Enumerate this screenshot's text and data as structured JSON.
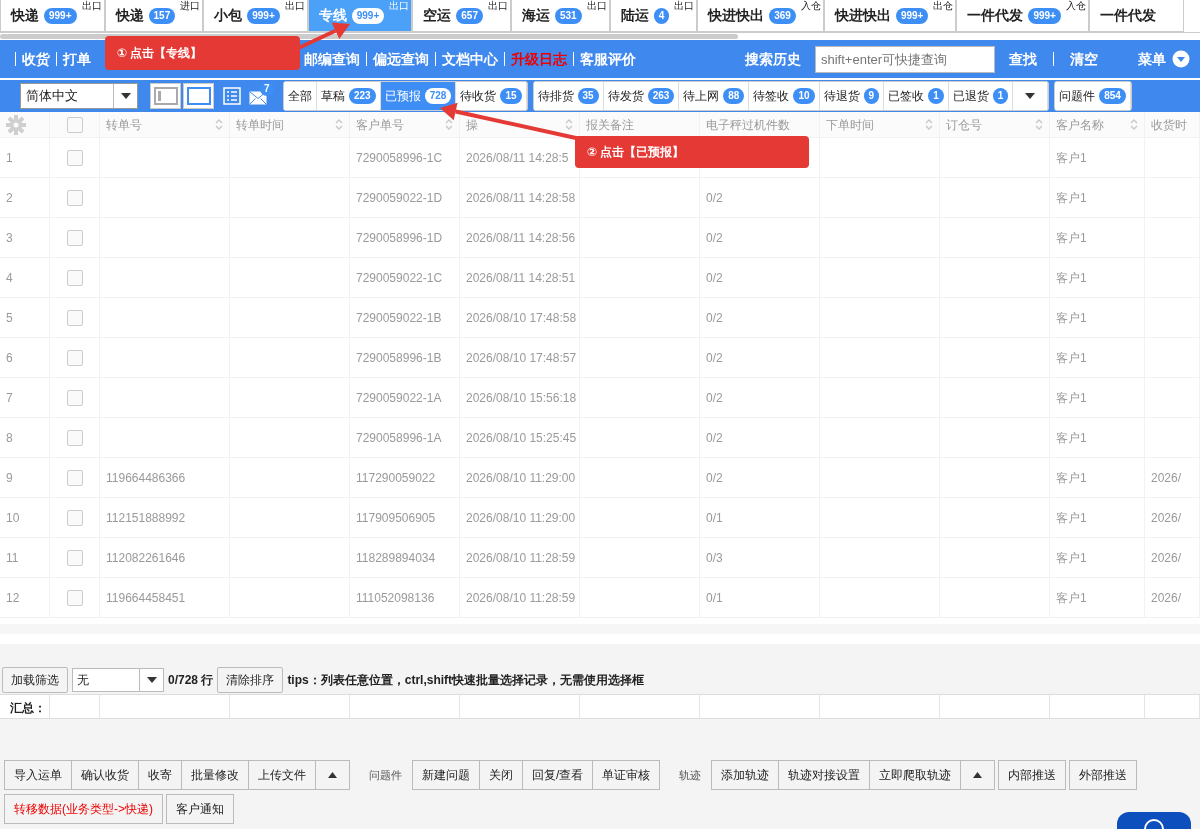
{
  "module_tabs": [
    {
      "label": "快递",
      "count": "999+",
      "tag": "出口",
      "selected": false
    },
    {
      "label": "快递",
      "count": "157",
      "tag": "进口",
      "selected": false
    },
    {
      "label": "小包",
      "count": "999+",
      "tag": "出口",
      "selected": false
    },
    {
      "label": "专线",
      "count": "999+",
      "tag": "出口",
      "selected": true
    },
    {
      "label": "空运",
      "count": "657",
      "tag": "出口",
      "selected": false
    },
    {
      "label": "海运",
      "count": "531",
      "tag": "出口",
      "selected": false
    },
    {
      "label": "陆运",
      "count": "4",
      "tag": "出口",
      "selected": false
    },
    {
      "label": "快进快出",
      "count": "369",
      "tag": "入仓",
      "selected": false
    },
    {
      "label": "快进快出",
      "count": "999+",
      "tag": "出仓",
      "selected": false
    },
    {
      "label": "一件代发",
      "count": "999+",
      "tag": "入仓",
      "selected": false
    },
    {
      "label": "一件代发",
      "selected": false
    }
  ],
  "nav": {
    "links": [
      {
        "label": "收货",
        "highlight": false
      },
      {
        "label": "打单",
        "highlight": false
      },
      {
        "label": "邮编查询",
        "highlight": false
      },
      {
        "label": "偏远查询",
        "highlight": false
      },
      {
        "label": "文档中心",
        "highlight": false
      },
      {
        "label": "升级日志",
        "highlight": true
      },
      {
        "label": "客服评价",
        "highlight": false
      }
    ],
    "search_history": "搜索历史",
    "search": {
      "placeholder": "shift+enter可快捷查询"
    },
    "find": "查找",
    "clear": "清空",
    "menu": "菜单"
  },
  "toolbar": {
    "language": "简体中文",
    "layouts": [
      {
        "selected": false
      },
      {
        "selected": true
      }
    ],
    "mail_count": "7",
    "status_groups": [
      {
        "menu": false,
        "items": [
          {
            "label": "全部",
            "selected": false
          },
          {
            "label": "草稿",
            "count": "223",
            "selected": false
          },
          {
            "label": "已预报",
            "count": "728",
            "selected": true
          },
          {
            "label": "待收货",
            "count": "15",
            "selected": false
          }
        ]
      },
      {
        "menu": true,
        "items": [
          {
            "label": "待排货",
            "count": "35",
            "selected": false
          },
          {
            "label": "待发货",
            "count": "263",
            "selected": false
          },
          {
            "label": "待上网",
            "count": "88",
            "selected": false
          },
          {
            "label": "待签收",
            "count": "10",
            "selected": false
          },
          {
            "label": "待退货",
            "count": "9",
            "selected": false
          },
          {
            "label": "已签收",
            "count": "1",
            "selected": false
          },
          {
            "label": "已退货",
            "count": "1",
            "selected": false
          }
        ]
      },
      {
        "menu": false,
        "items": [
          {
            "label": "问题件",
            "count": "854",
            "selected": false
          }
        ]
      }
    ]
  },
  "table": {
    "select_all": {
      "checked": false
    },
    "columns": [
      {
        "label": "转单号",
        "sortable": true
      },
      {
        "label": "转单时间",
        "sortable": true
      },
      {
        "label": "客户单号",
        "sortable": true
      },
      {
        "label": "操",
        "sortable": true
      },
      {
        "label": "报关备注",
        "sortable": false
      },
      {
        "label": "电子秤过机件数",
        "sortable": false
      },
      {
        "label": "下单时间",
        "sortable": true
      },
      {
        "label": "订仓号",
        "sortable": true
      },
      {
        "label": "客户名称",
        "sortable": true
      },
      {
        "label": "收货时",
        "sortable": false
      }
    ],
    "rows": [
      {
        "no": "1",
        "checked": false,
        "cells": [
          null,
          null,
          "7290058996-1C",
          "2026/08/11 14:28:5",
          null,
          null,
          null,
          null,
          "客户1",
          null
        ]
      },
      {
        "no": "2",
        "checked": false,
        "cells": [
          null,
          null,
          "7290059022-1D",
          "2026/08/11 14:28:58",
          null,
          "0/2",
          null,
          null,
          "客户1",
          null
        ]
      },
      {
        "no": "3",
        "checked": false,
        "cells": [
          null,
          null,
          "7290058996-1D",
          "2026/08/11 14:28:56",
          null,
          "0/2",
          null,
          null,
          "客户1",
          null
        ]
      },
      {
        "no": "4",
        "checked": false,
        "cells": [
          null,
          null,
          "7290059022-1C",
          "2026/08/11 14:28:51",
          null,
          "0/2",
          null,
          null,
          "客户1",
          null
        ]
      },
      {
        "no": "5",
        "checked": false,
        "cells": [
          null,
          null,
          "7290059022-1B",
          "2026/08/10 17:48:58",
          null,
          "0/2",
          null,
          null,
          "客户1",
          null
        ]
      },
      {
        "no": "6",
        "checked": false,
        "cells": [
          null,
          null,
          "7290058996-1B",
          "2026/08/10 17:48:57",
          null,
          "0/2",
          null,
          null,
          "客户1",
          null
        ]
      },
      {
        "no": "7",
        "checked": false,
        "cells": [
          null,
          null,
          "7290059022-1A",
          "2026/08/10 15:56:18",
          null,
          "0/2",
          null,
          null,
          "客户1",
          null
        ]
      },
      {
        "no": "8",
        "checked": false,
        "cells": [
          null,
          null,
          "7290058996-1A",
          "2026/08/10 15:25:45",
          null,
          "0/2",
          null,
          null,
          "客户1",
          null
        ]
      },
      {
        "no": "9",
        "checked": false,
        "cells": [
          "119664486366",
          null,
          "117290059022",
          "2026/08/10 11:29:00",
          null,
          "0/2",
          null,
          null,
          "客户1",
          "2026/"
        ]
      },
      {
        "no": "10",
        "checked": false,
        "cells": [
          "112151888992",
          null,
          "117909506905",
          "2026/08/10 11:29:00",
          null,
          "0/1",
          null,
          null,
          "客户1",
          "2026/"
        ]
      },
      {
        "no": "11",
        "checked": false,
        "cells": [
          "112082261646",
          null,
          "118289894034",
          "2026/08/10 11:28:59",
          null,
          "0/3",
          null,
          null,
          "客户1",
          "2026/"
        ]
      },
      {
        "no": "12",
        "checked": false,
        "cells": [
          "119664458451",
          null,
          "111052098136",
          "2026/08/10 11:28:59",
          null,
          "0/1",
          null,
          null,
          "客户1",
          "2026/"
        ]
      }
    ]
  },
  "filter_bar": {
    "load_button": "加载筛选",
    "preset": "无",
    "row_count": "0/728 行",
    "clear_sort": "清除排序",
    "tips": "tips：列表任意位置，ctrl,shift快速批量选择记录，无需使用选择框"
  },
  "summary": {
    "label": "汇总："
  },
  "actions": [
    {
      "kind": "group",
      "menu": true,
      "buttons": [
        {
          "label": "导入运单",
          "danger": false
        },
        {
          "label": "确认收货",
          "danger": false
        },
        {
          "label": "收寄",
          "danger": false
        },
        {
          "label": "批量修改",
          "danger": false
        },
        {
          "label": "上传文件",
          "danger": false
        }
      ]
    },
    {
      "kind": "caption",
      "label": "问题件"
    },
    {
      "kind": "group",
      "menu": false,
      "buttons": [
        {
          "label": "新建问题",
          "danger": false
        },
        {
          "label": "关闭",
          "danger": false
        },
        {
          "label": "回复/查看",
          "danger": false
        },
        {
          "label": "单证审核",
          "danger": false
        }
      ]
    },
    {
      "kind": "caption",
      "label": "轨迹"
    },
    {
      "kind": "group",
      "menu": true,
      "buttons": [
        {
          "label": "添加轨迹",
          "danger": false
        },
        {
          "label": "轨迹对接设置",
          "danger": false
        },
        {
          "label": "立即爬取轨迹",
          "danger": false
        }
      ]
    },
    {
      "kind": "group",
      "menu": false,
      "buttons": [
        {
          "label": "内部推送",
          "danger": false
        }
      ]
    },
    {
      "kind": "group",
      "menu": false,
      "buttons": [
        {
          "label": "外部推送",
          "danger": false
        }
      ]
    },
    {
      "kind": "group",
      "menu": false,
      "buttons": [
        {
          "label": "转移数据(业务类型->快递)",
          "danger": true
        }
      ]
    },
    {
      "kind": "group",
      "menu": false,
      "buttons": [
        {
          "label": "客户通知",
          "danger": false
        }
      ]
    }
  ],
  "callouts": [
    {
      "text": "① 点击【专线】"
    },
    {
      "text": "② 点击【已预报】"
    }
  ]
}
